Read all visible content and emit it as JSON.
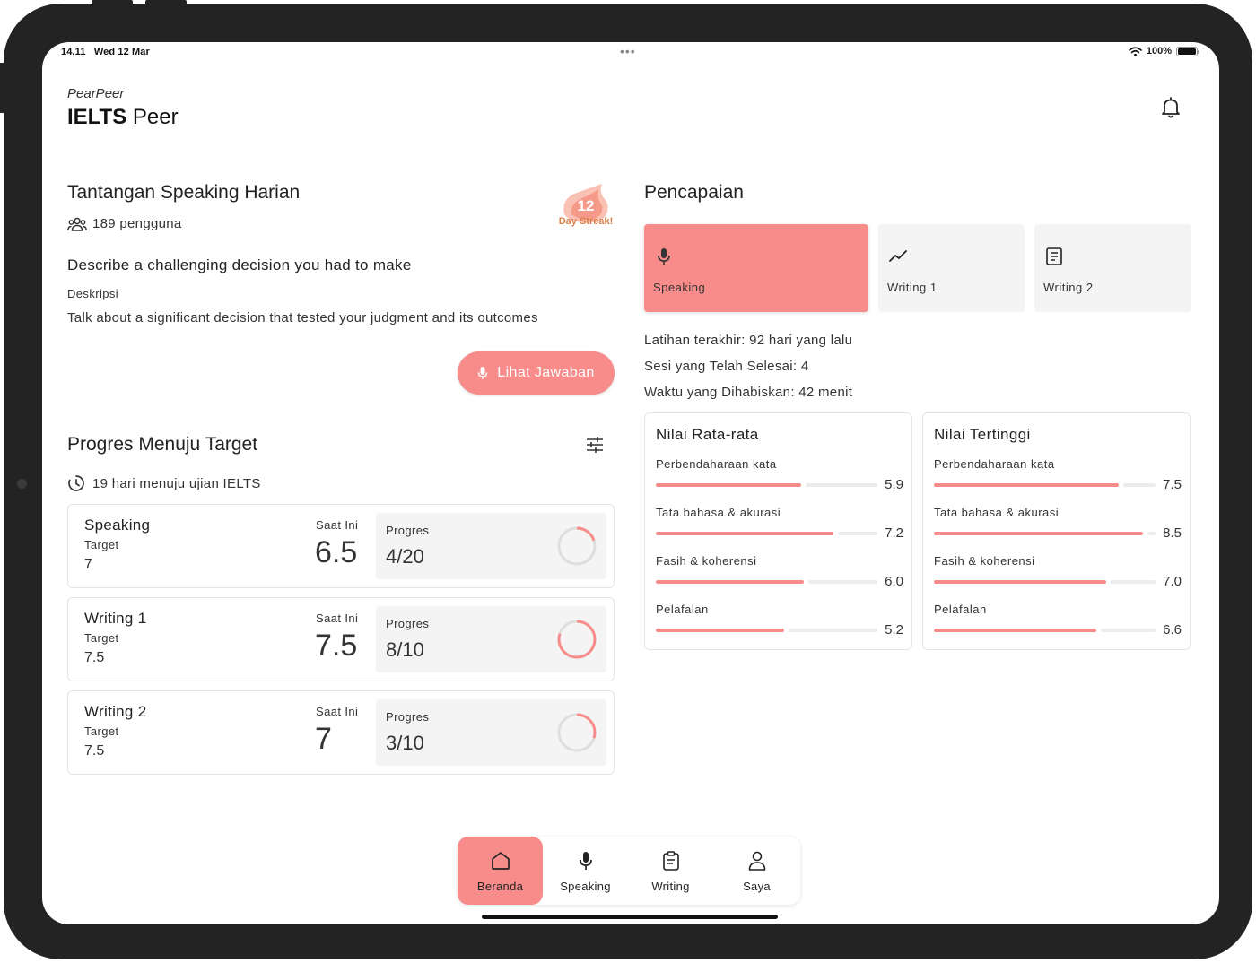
{
  "status": {
    "time": "14.11",
    "date": "Wed 12 Mar",
    "dots": "•••",
    "battery": "100%"
  },
  "header": {
    "brand_sub": "PearPeer",
    "brand_title_bold": "IELTS",
    "brand_title_rest": " Peer"
  },
  "challenge": {
    "title": "Tantangan Speaking Harian",
    "users": "189 pengguna",
    "streak_number": "12",
    "streak_label": "Day Streak!",
    "question": "Describe a challenging decision you had to make",
    "desc_label": "Deskripsi",
    "desc_text": "Talk about a significant decision that tested your judgment and its outcomes",
    "button_label": "Lihat Jawaban"
  },
  "progress": {
    "title": "Progres Menuju Target",
    "days_left": "19 hari menuju ujian IELTS",
    "target_label": "Target",
    "now_label": "Saat Ini",
    "progress_label": "Progres",
    "cards": [
      {
        "name": "Speaking",
        "target": "7",
        "now": "6.5",
        "progress": "4/20",
        "fraction": 0.2
      },
      {
        "name": "Writing 1",
        "target": "7.5",
        "now": "7.5",
        "progress": "8/10",
        "fraction": 0.8
      },
      {
        "name": "Writing 2",
        "target": "7.5",
        "now": "7",
        "progress": "3/10",
        "fraction": 0.3
      }
    ]
  },
  "achievements": {
    "title": "Pencapaian",
    "tabs": [
      {
        "label": "Speaking",
        "icon": "mic-icon"
      },
      {
        "label": "Writing 1",
        "icon": "trend-line-icon"
      },
      {
        "label": "Writing 2",
        "icon": "document-icon"
      }
    ],
    "stats": {
      "last_practice": "Latihan terakhir: 92 hari yang lalu",
      "sessions": "Sesi yang Telah Selesai: 4",
      "time_spent": "Waktu yang Dihabiskan: 42 menit"
    },
    "average": {
      "title": "Nilai Rata-rata",
      "skills": [
        {
          "name": "Perbendaharaan kata",
          "value": "5.9",
          "score": 5.9
        },
        {
          "name": "Tata bahasa & akurasi",
          "value": "7.2",
          "score": 7.2
        },
        {
          "name": "Fasih & koherensi",
          "value": "6.0",
          "score": 6.0
        },
        {
          "name": "Pelafalan",
          "value": "5.2",
          "score": 5.2
        }
      ]
    },
    "highest": {
      "title": "Nilai Tertinggi",
      "skills": [
        {
          "name": "Perbendaharaan kata",
          "value": "7.5",
          "score": 7.5
        },
        {
          "name": "Tata bahasa & akurasi",
          "value": "8.5",
          "score": 8.5
        },
        {
          "name": "Fasih & koherensi",
          "value": "7.0",
          "score": 7.0
        },
        {
          "name": "Pelafalan",
          "value": "6.6",
          "score": 6.6
        }
      ]
    },
    "max_score": 9
  },
  "nav": {
    "items": [
      {
        "label": "Beranda",
        "icon": "home-icon"
      },
      {
        "label": "Speaking",
        "icon": "mic-icon"
      },
      {
        "label": "Writing",
        "icon": "clipboard-icon"
      },
      {
        "label": "Saya",
        "icon": "user-icon"
      }
    ]
  },
  "colors": {
    "accent": "#f78c8a",
    "track": "#ececec",
    "tile": "#f4f4f4"
  }
}
